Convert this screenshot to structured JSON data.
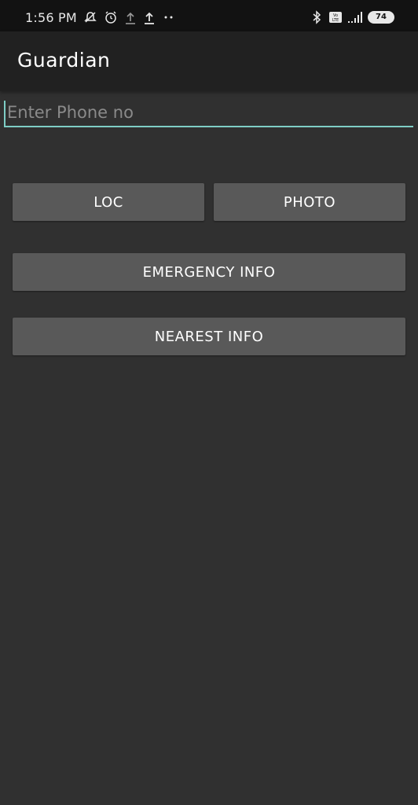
{
  "status_bar": {
    "time": "1:56 PM",
    "icons_left": [
      "muted-notification-icon",
      "alarm-clock-icon",
      "upload-icon",
      "upload-icon",
      "more-dots-icon"
    ],
    "icons_right": [
      "bluetooth-icon",
      "volte-icon",
      "signal-icon",
      "battery-icon"
    ],
    "battery_level": "74"
  },
  "app_bar": {
    "title": "Guardian"
  },
  "phone_input": {
    "placeholder": "Enter Phone no",
    "value": ""
  },
  "buttons": {
    "loc": "LOC",
    "photo": "PHOTO",
    "emergency_info": "EMERGENCY INFO",
    "nearest_info": "NEAREST INFO"
  },
  "colors": {
    "background": "#303030",
    "app_bar": "#212121",
    "status_bar": "#121212",
    "button": "#595959",
    "accent": "#7ecdc5"
  }
}
